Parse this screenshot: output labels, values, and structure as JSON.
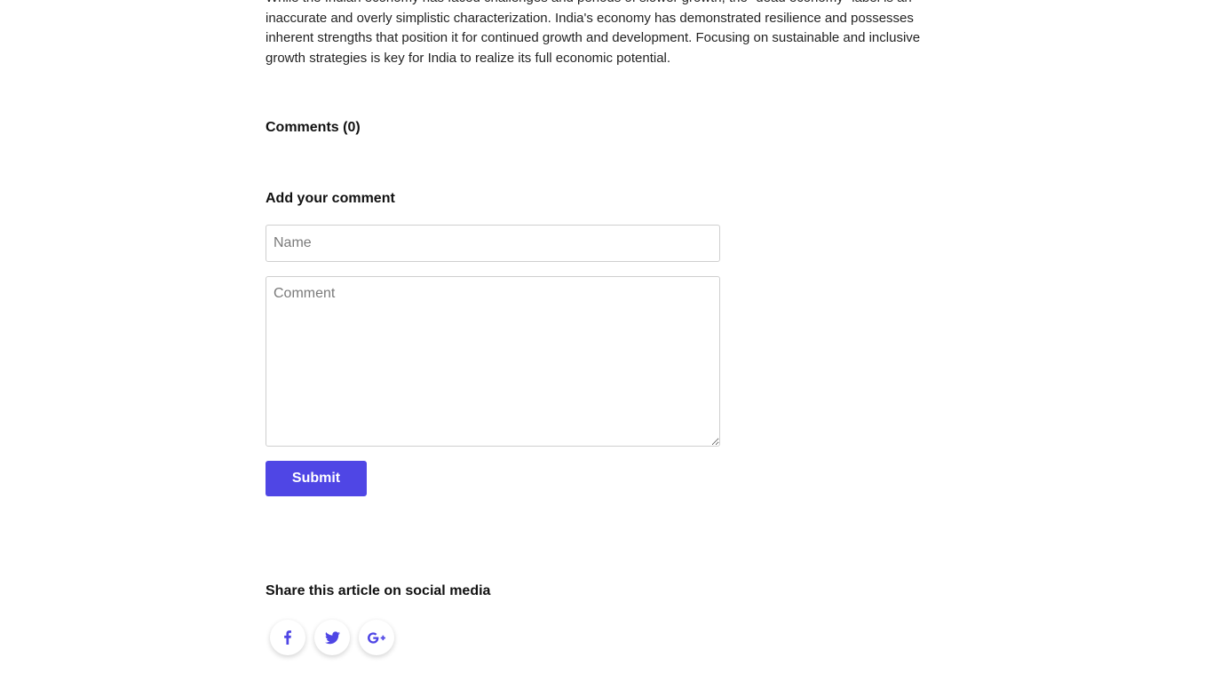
{
  "article": {
    "intro_text": "While the Indian economy has faced challenges and periods of slower growth, the \"dead economy\" label is an inaccurate and overly simplistic characterization. India's economy has demonstrated resilience and possesses inherent strengths that position it for continued growth and development. Focusing on sustainable and inclusive growth strategies is key for India to realize its full economic potential."
  },
  "comments": {
    "heading": "Comments (0)"
  },
  "comment_form": {
    "heading": "Add your comment",
    "name_placeholder": "Name",
    "comment_placeholder": "Comment",
    "submit_label": "Submit"
  },
  "share": {
    "heading": "Share this article on social media",
    "networks": [
      "facebook-icon",
      "twitter-icon",
      "google-plus-icon"
    ]
  },
  "colors": {
    "accent": "#4f46e5"
  }
}
